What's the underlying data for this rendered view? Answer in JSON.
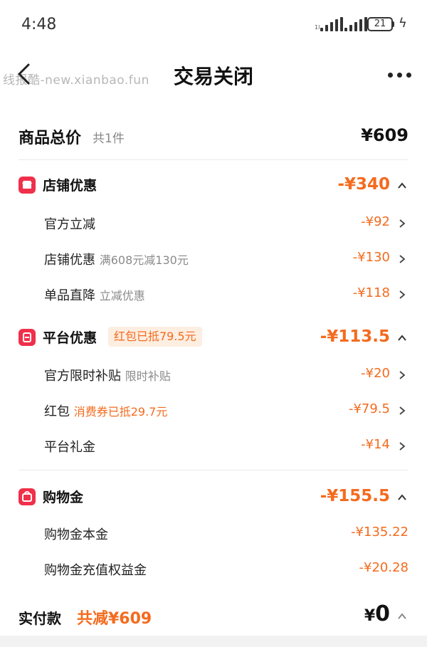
{
  "status": {
    "time": "4:48",
    "battery": "21"
  },
  "header": {
    "watermark": "线报酷-new.xianbao.fun",
    "title": "交易关闭"
  },
  "total": {
    "label": "商品总价",
    "count": "共1件",
    "amount": "¥609"
  },
  "sections": [
    {
      "label": "店铺优惠",
      "amount": "-¥340",
      "items": [
        {
          "label": "官方立减",
          "note": "",
          "amount": "-¥92"
        },
        {
          "label": "店铺优惠",
          "note": "满608元减130元",
          "amount": "-¥130"
        },
        {
          "label": "单品直降",
          "note": "立减优惠",
          "amount": "-¥118"
        }
      ]
    },
    {
      "label": "平台优惠",
      "pill": "红包已抵79.5元",
      "amount": "-¥113.5",
      "items": [
        {
          "label": "官方限时补贴",
          "note": "限时补贴",
          "amount": "-¥20"
        },
        {
          "label": "红包",
          "note": "消费券已抵29.7元",
          "amount": "-¥79.5"
        },
        {
          "label": "平台礼金",
          "note": "",
          "amount": "-¥14"
        }
      ]
    },
    {
      "label": "购物金",
      "amount": "-¥155.5",
      "items": [
        {
          "label": "购物金本金",
          "note": "",
          "amount": "-¥135.22"
        },
        {
          "label": "购物金充值权益金",
          "note": "",
          "amount": "-¥20.28"
        }
      ]
    }
  ],
  "payment": {
    "label": "实付款",
    "saved": "共减¥609",
    "currency": "¥",
    "amount": "0"
  },
  "colors": {
    "accent": "#f46b1e",
    "icon_red": "#f0304a",
    "pill_bg": "#fdeee2"
  }
}
